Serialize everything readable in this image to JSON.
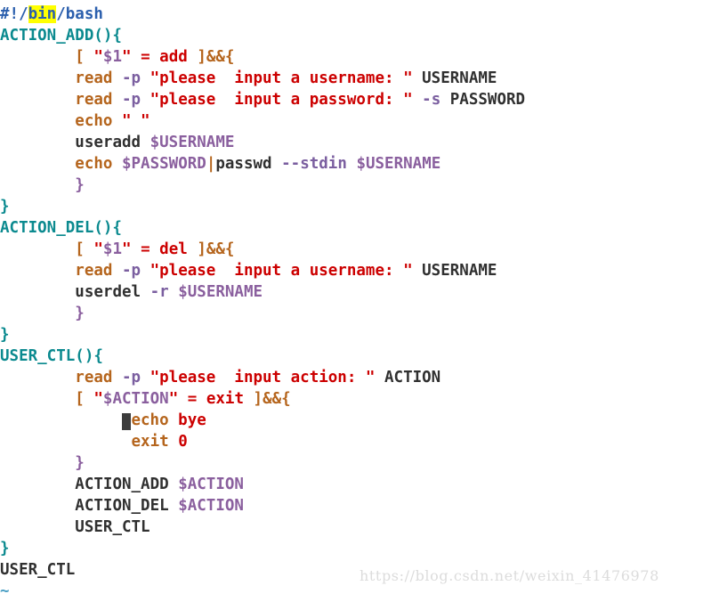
{
  "editor": {
    "type": "vim-text-editor",
    "filetype": "bash",
    "background_color": "#ffffff",
    "cursor": {
      "present": true,
      "line_index": 20,
      "color": "#3C3C3C",
      "glyph": " "
    },
    "search_highlight": {
      "text": "bin",
      "background_color": "#FFFF00",
      "foreground_color": "#2B5FAD"
    },
    "palette": {
      "shebang_blue": "#2B5FAD",
      "function_teal": "#0B8A8F",
      "builtin_orange": "#B5651D",
      "string_red": "#CC0000",
      "variable_purple": "#8A5F9E",
      "option_purple": "#7B5FA0",
      "plain_dark": "#303030",
      "tilde_blue": "#4A9FC4",
      "watermark_gray": "#DCDCDC"
    },
    "empty_line_marker": "~",
    "lines": [
      {
        "indent": "",
        "tokens": [
          {
            "text": "#!/",
            "style": "shebang"
          },
          {
            "text": "bin",
            "style": "hl"
          },
          {
            "text": "/bash",
            "style": "shebang"
          }
        ]
      },
      {
        "indent": "",
        "tokens": [
          {
            "text": "ACTION_ADD(){",
            "style": "func"
          }
        ]
      },
      {
        "indent": "        ",
        "tokens": [
          {
            "text": "[ ",
            "style": "cmd"
          },
          {
            "text": "\"",
            "style": "str"
          },
          {
            "text": "$1",
            "style": "var"
          },
          {
            "text": "\"",
            "style": "str"
          },
          {
            "text": " = add ",
            "style": "str"
          },
          {
            "text": "]",
            "style": "cmd"
          },
          {
            "text": "&&{",
            "style": "cmd"
          }
        ]
      },
      {
        "indent": "        ",
        "tokens": [
          {
            "text": "read ",
            "style": "cmd"
          },
          {
            "text": "-p ",
            "style": "opt"
          },
          {
            "text": "\"please  input a username: \"",
            "style": "str"
          },
          {
            "text": " USERNAME",
            "style": "plain"
          }
        ]
      },
      {
        "indent": "        ",
        "tokens": [
          {
            "text": "read ",
            "style": "cmd"
          },
          {
            "text": "-p ",
            "style": "opt"
          },
          {
            "text": "\"please  input a password: \"",
            "style": "str"
          },
          {
            "text": " ",
            "style": "plain"
          },
          {
            "text": "-s",
            "style": "opt"
          },
          {
            "text": " PASSWORD",
            "style": "plain"
          }
        ]
      },
      {
        "indent": "        ",
        "tokens": [
          {
            "text": "echo ",
            "style": "cmd"
          },
          {
            "text": "\" \"",
            "style": "str"
          }
        ]
      },
      {
        "indent": "        ",
        "tokens": [
          {
            "text": "useradd ",
            "style": "plain"
          },
          {
            "text": "$USERNAME",
            "style": "var"
          }
        ]
      },
      {
        "indent": "        ",
        "tokens": [
          {
            "text": "echo ",
            "style": "cmd"
          },
          {
            "text": "$PASSWORD",
            "style": "var"
          },
          {
            "text": "|",
            "style": "cmd"
          },
          {
            "text": "passwd ",
            "style": "plain"
          },
          {
            "text": "--stdin",
            "style": "opt"
          },
          {
            "text": " ",
            "style": "plain"
          },
          {
            "text": "$USERNAME",
            "style": "var"
          }
        ]
      },
      {
        "indent": "        ",
        "tokens": [
          {
            "text": "}",
            "style": "brace-p"
          }
        ]
      },
      {
        "indent": "",
        "tokens": [
          {
            "text": "}",
            "style": "func"
          }
        ]
      },
      {
        "indent": "",
        "tokens": [
          {
            "text": "ACTION_DEL(){",
            "style": "func"
          }
        ]
      },
      {
        "indent": "        ",
        "tokens": [
          {
            "text": "[ ",
            "style": "cmd"
          },
          {
            "text": "\"",
            "style": "str"
          },
          {
            "text": "$1",
            "style": "var"
          },
          {
            "text": "\"",
            "style": "str"
          },
          {
            "text": " = del ",
            "style": "str"
          },
          {
            "text": "]",
            "style": "cmd"
          },
          {
            "text": "&&{",
            "style": "cmd"
          }
        ]
      },
      {
        "indent": "        ",
        "tokens": [
          {
            "text": "read ",
            "style": "cmd"
          },
          {
            "text": "-p ",
            "style": "opt"
          },
          {
            "text": "\"please  input a username: \"",
            "style": "str"
          },
          {
            "text": " USERNAME",
            "style": "plain"
          }
        ]
      },
      {
        "indent": "        ",
        "tokens": [
          {
            "text": "userdel ",
            "style": "plain"
          },
          {
            "text": "-r",
            "style": "opt"
          },
          {
            "text": " ",
            "style": "plain"
          },
          {
            "text": "$USERNAME",
            "style": "var"
          }
        ]
      },
      {
        "indent": "        ",
        "tokens": [
          {
            "text": "}",
            "style": "brace-p"
          }
        ]
      },
      {
        "indent": "",
        "tokens": [
          {
            "text": "}",
            "style": "func"
          }
        ]
      },
      {
        "indent": "",
        "tokens": [
          {
            "text": "USER_CTL(){",
            "style": "func"
          }
        ]
      },
      {
        "indent": "        ",
        "tokens": [
          {
            "text": "read ",
            "style": "cmd"
          },
          {
            "text": "-p ",
            "style": "opt"
          },
          {
            "text": "\"please  input action: \"",
            "style": "str"
          },
          {
            "text": " ACTION",
            "style": "plain"
          }
        ]
      },
      {
        "indent": "        ",
        "tokens": [
          {
            "text": "[ ",
            "style": "cmd"
          },
          {
            "text": "\"",
            "style": "str"
          },
          {
            "text": "$ACTION",
            "style": "var"
          },
          {
            "text": "\"",
            "style": "str"
          },
          {
            "text": " = exit ",
            "style": "str"
          },
          {
            "text": "]",
            "style": "cmd"
          },
          {
            "text": "&&{",
            "style": "cmd"
          }
        ]
      },
      {
        "indent": "             ",
        "tokens": [
          {
            "text": " ",
            "style": "cursor"
          },
          {
            "text": "echo ",
            "style": "cmd"
          },
          {
            "text": "bye",
            "style": "str"
          }
        ]
      },
      {
        "indent": "              ",
        "tokens": [
          {
            "text": "exit ",
            "style": "cmd"
          },
          {
            "text": "0",
            "style": "str"
          }
        ]
      },
      {
        "indent": "        ",
        "tokens": [
          {
            "text": "}",
            "style": "brace-p"
          }
        ]
      },
      {
        "indent": "        ",
        "tokens": [
          {
            "text": "ACTION_ADD ",
            "style": "plain"
          },
          {
            "text": "$ACTION",
            "style": "var"
          }
        ]
      },
      {
        "indent": "        ",
        "tokens": [
          {
            "text": "ACTION_DEL ",
            "style": "plain"
          },
          {
            "text": "$ACTION",
            "style": "var"
          }
        ]
      },
      {
        "indent": "        ",
        "tokens": [
          {
            "text": "USER_CTL",
            "style": "plain"
          }
        ]
      },
      {
        "indent": "",
        "tokens": [
          {
            "text": "}",
            "style": "func"
          }
        ]
      },
      {
        "indent": "",
        "tokens": [
          {
            "text": "USER_CTL",
            "style": "plain"
          }
        ]
      },
      {
        "indent": "",
        "tokens": [
          {
            "text": "~",
            "style": "tilde"
          }
        ]
      }
    ]
  },
  "watermark": {
    "text": "https://blog.csdn.net/weixin_41476978"
  }
}
